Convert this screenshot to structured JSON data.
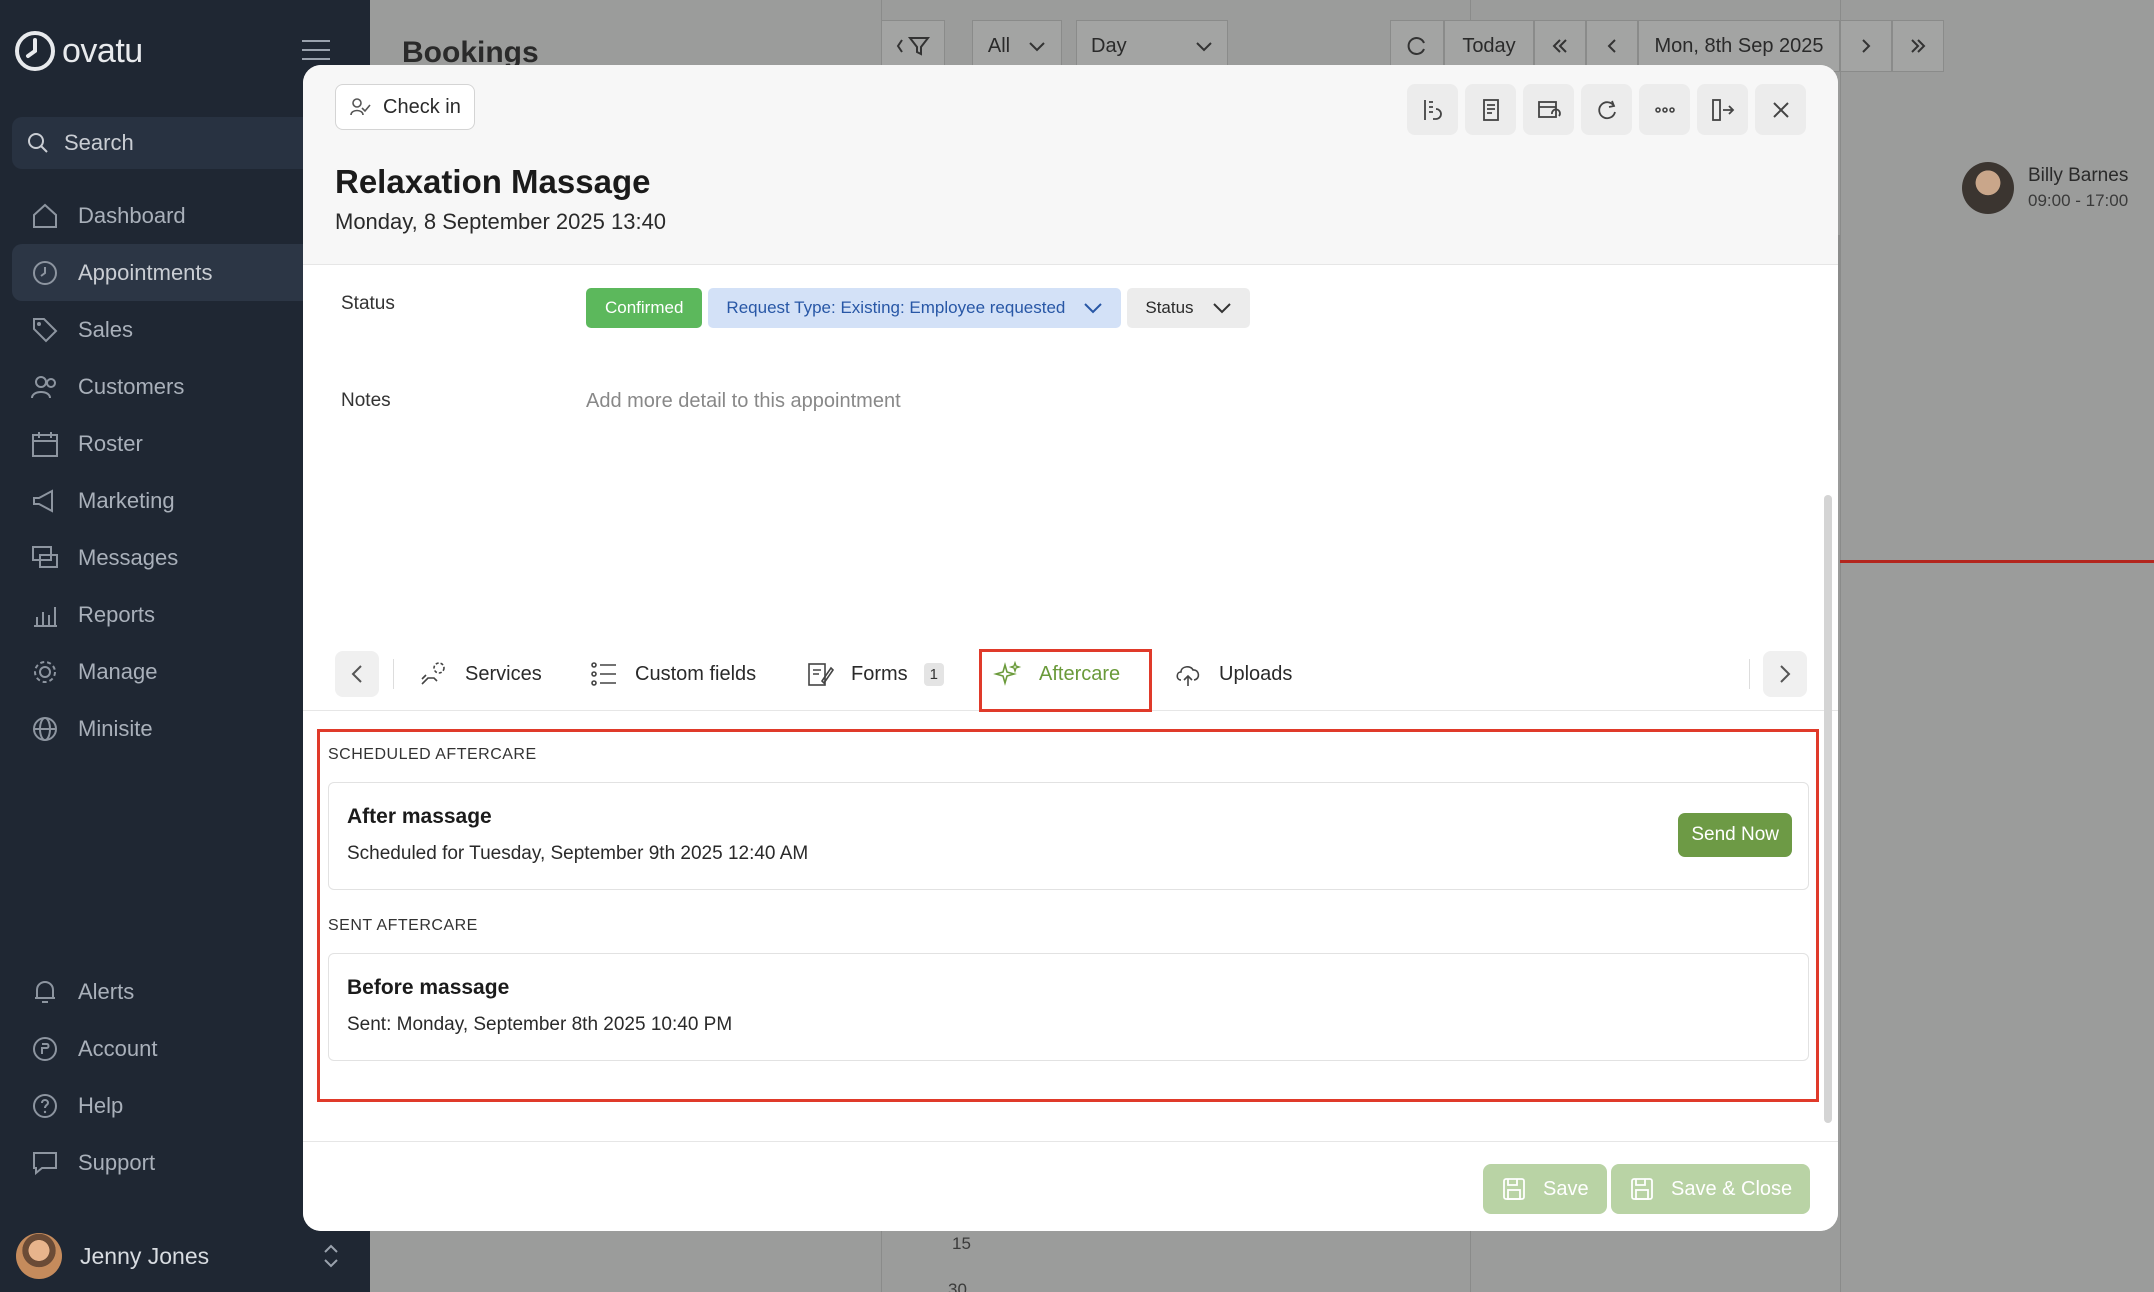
{
  "app": {
    "name": "ovatu"
  },
  "sidebar": {
    "search_label": "Search",
    "items": [
      {
        "label": "Dashboard",
        "icon": "home-icon"
      },
      {
        "label": "Appointments",
        "icon": "clock-icon",
        "active": true
      },
      {
        "label": "Sales",
        "icon": "tag-icon"
      },
      {
        "label": "Customers",
        "icon": "users-icon"
      },
      {
        "label": "Roster",
        "icon": "calendar-icon"
      },
      {
        "label": "Marketing",
        "icon": "megaphone-icon"
      },
      {
        "label": "Messages",
        "icon": "chat-icon"
      },
      {
        "label": "Reports",
        "icon": "chart-icon"
      },
      {
        "label": "Manage",
        "icon": "gear-icon"
      },
      {
        "label": "Minisite",
        "icon": "globe-icon"
      }
    ],
    "bottom_items": [
      {
        "label": "Alerts",
        "icon": "bell-icon"
      },
      {
        "label": "Account",
        "icon": "account-icon"
      },
      {
        "label": "Help",
        "icon": "help-icon"
      },
      {
        "label": "Support",
        "icon": "support-icon"
      }
    ],
    "user_name": "Jenny Jones"
  },
  "background": {
    "page_title": "Bookings",
    "filter_all": "All",
    "view_day": "Day",
    "today": "Today",
    "date": "Mon, 8th Sep 2025",
    "staff_name": "Billy Barnes",
    "staff_hours": "09:00 - 17:00",
    "tick_15": "15",
    "tick_30": "30"
  },
  "modal": {
    "check_in": "Check in",
    "title": "Relaxation Massage",
    "datetime": "Monday, 8 September 2025 13:40",
    "status_label": "Status",
    "status_confirmed": "Confirmed",
    "request_type": "Request Type: Existing: Employee requested",
    "status_dropdown": "Status",
    "notes_label": "Notes",
    "notes_placeholder": "Add more detail to this appointment",
    "tabs": {
      "services": "Services",
      "custom_fields": "Custom fields",
      "forms": "Forms",
      "forms_count": "1",
      "aftercare": "Aftercare",
      "uploads": "Uploads"
    },
    "aftercare": {
      "scheduled_heading": "SCHEDULED AFTERCARE",
      "scheduled": {
        "title": "After massage",
        "subtitle": "Scheduled for Tuesday, September 9th 2025 12:40 AM",
        "action": "Send Now"
      },
      "sent_heading": "SENT AFTERCARE",
      "sent": {
        "title": "Before massage",
        "subtitle": "Sent: Monday, September 8th 2025 10:40 PM"
      }
    },
    "footer": {
      "save": "Save",
      "save_close": "Save & Close"
    }
  },
  "colors": {
    "sidebar_bg": "#1f2733",
    "confirmed": "#5cb85c",
    "accent_green": "#6d9a45",
    "highlight_red": "#e03a2a",
    "request_chip_bg": "#d3e1f7"
  }
}
